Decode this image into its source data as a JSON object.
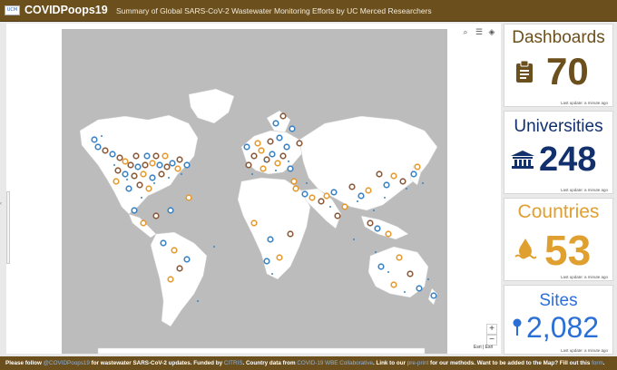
{
  "header": {
    "logo_text": "UCM",
    "title": "COVIDPoops19",
    "subtitle": "Summary of Global SARS-CoV-2 Wastewater Monitoring Efforts by UC Merced Researchers"
  },
  "map": {
    "tools": [
      "search-icon",
      "list-icon",
      "layers-icon"
    ],
    "zoom_in": "+",
    "zoom_out": "−",
    "attribution": "Esri | Esri",
    "colors": {
      "land": "#ffffff",
      "water": "#bcbcbc",
      "marker_blue": "#3b83c4",
      "marker_brown": "#8a5a3a",
      "marker_orange": "#e59b2f"
    }
  },
  "cards": [
    {
      "label": "Dashboards",
      "value": "70",
      "icon": "clipboard-icon",
      "color": "#6b4f1d",
      "update": "Last update: a minute ago"
    },
    {
      "label": "Universities",
      "value": "248",
      "icon": "university-icon",
      "color": "#12306b",
      "update": "Last update: a minute ago"
    },
    {
      "label": "Countries",
      "value": "53",
      "icon": "water-drop-icon",
      "color": "#e0a030",
      "update": "Last update: a minute ago"
    },
    {
      "label": "Sites",
      "value": "2,082",
      "icon": "map-pin-icon",
      "color": "#2a6fd6",
      "update": "Last update: a minute ago"
    }
  ],
  "footer": {
    "t1": "Please follow ",
    "l1": "@COVIDPoops19",
    "t2": " for wastewater SARS-CoV-2 updates. Funded by ",
    "l2": "CITRIS",
    "t3": ". Country data from ",
    "l3": "COVID-19 WBE Collaborative",
    "t4": ". Link to our ",
    "l4": "pre-print",
    "t5": " for our methods. Want to be added to the Map? Fill out this ",
    "l5": "form",
    "t6": "."
  }
}
